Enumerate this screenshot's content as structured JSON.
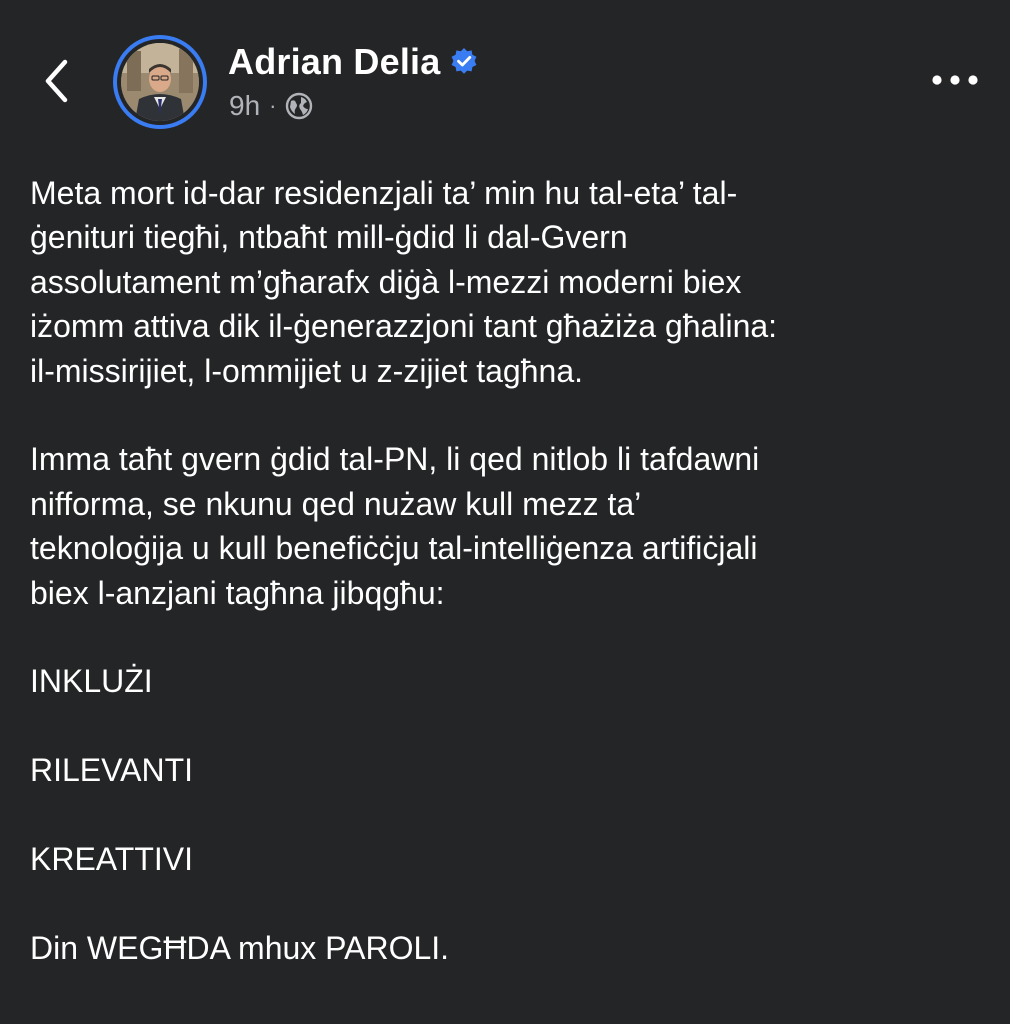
{
  "header": {
    "author_name": "Adrian Delia",
    "timestamp": "9h",
    "separator": "·",
    "audience_icon": "globe-icon",
    "verified_icon": "verified-badge-icon",
    "back_icon": "chevron-left-icon",
    "more_icon": "more-horizontal-icon"
  },
  "colors": {
    "background": "#242527",
    "text": "#ffffff",
    "secondary_text": "#b0b3b8",
    "accent": "#3a7cf2"
  },
  "post": {
    "paragraph1": [
      "Meta mort id-dar residenzjali ta’ min hu tal-eta’ tal-",
      "ġenituri tiegħi, ntbaħt mill-ġdid li dal-Gvern",
      "assolutament m’għarafx diġà l-mezzi moderni biex",
      "iżomm attiva dik il-ġenerazzjoni tant għażiża għalina:",
      "il-missirijiet, l-ommijiet u z-zijiet tagħna."
    ],
    "paragraph2": [
      "Imma taħt gvern ġdid tal-PN, li qed nitlob li tafdawni",
      "nifforma, se nkunu qed nużaw kull mezz ta’",
      "teknoloġija u kull benefiċċju tal-intelliġenza artifiċjali",
      "biex l-anzjani tagħna jibqgħu:"
    ],
    "item1": "INKLUŻI",
    "item2": "RILEVANTI",
    "item3": "KREATTIVI",
    "closing": "Din WEGĦDA mhux PAROLI."
  }
}
